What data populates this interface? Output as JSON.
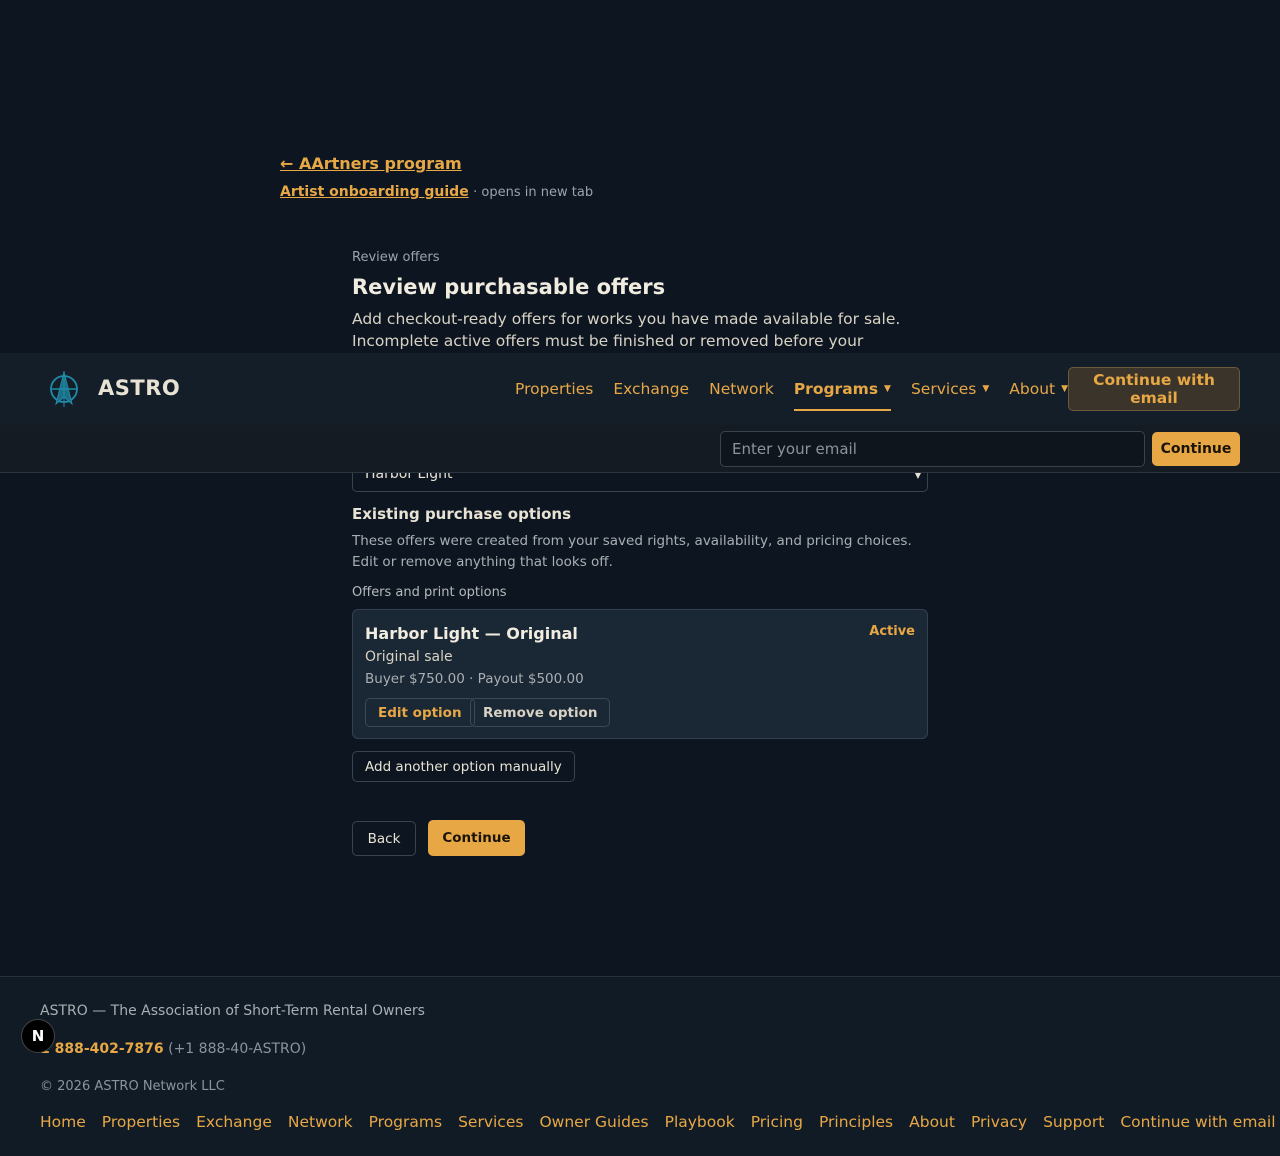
{
  "breadcrumb": {
    "back_label": "← AArtners program",
    "guide_label": "Artist onboarding guide",
    "guide_note": "· opens in new tab"
  },
  "header": {
    "eyebrow": "Review offers",
    "title": "Review purchasable offers",
    "intro": "Add checkout-ready offers for works you have made available for sale. Incomplete active offers must be finished or removed before your storefront"
  },
  "nav": {
    "brand": "ASTRO",
    "items": [
      {
        "label": "Properties",
        "has_menu": false
      },
      {
        "label": "Exchange",
        "has_menu": false
      },
      {
        "label": "Network",
        "has_menu": false
      },
      {
        "label": "Programs",
        "has_menu": true,
        "active": true
      },
      {
        "label": "Services",
        "has_menu": true
      },
      {
        "label": "About",
        "has_menu": true
      }
    ],
    "cta_label": "Continue with email"
  },
  "email_bar": {
    "placeholder": "Enter your email",
    "button_label": "Continue"
  },
  "artwork_select": {
    "value": "Harbor Light"
  },
  "existing": {
    "title": "Existing purchase options",
    "description": "These offers were created from your saved rights, availability, and pricing choices. Edit or remove anything that looks off.",
    "list_label": "Offers and print options",
    "offers": [
      {
        "title": "Harbor Light — Original",
        "status": "Active",
        "type": "Original sale",
        "pricing": "Buyer $750.00 · Payout $500.00",
        "edit_label": "Edit option",
        "remove_label": "Remove option"
      }
    ],
    "add_label": "Add another option manually"
  },
  "actions": {
    "back_label": "Back",
    "continue_label": "Continue"
  },
  "footer": {
    "org": "ASTRO — The Association of Short-Term Rental Owners",
    "phone": "1 888-402-7876",
    "phone_alt": "(+1 888-40-ASTRO)",
    "copyright": "© 2026 ASTRO Network LLC",
    "links": [
      "Home",
      "Properties",
      "Exchange",
      "Network",
      "Programs",
      "Services",
      "Owner Guides",
      "Playbook",
      "Pricing",
      "Principles",
      "About",
      "Privacy",
      "Support",
      "Continue with email"
    ]
  },
  "fab_letter": "N",
  "colors": {
    "background": "#0d1620",
    "accent": "#e8a745",
    "card": "#1a2734",
    "navbar": "#131e29"
  }
}
